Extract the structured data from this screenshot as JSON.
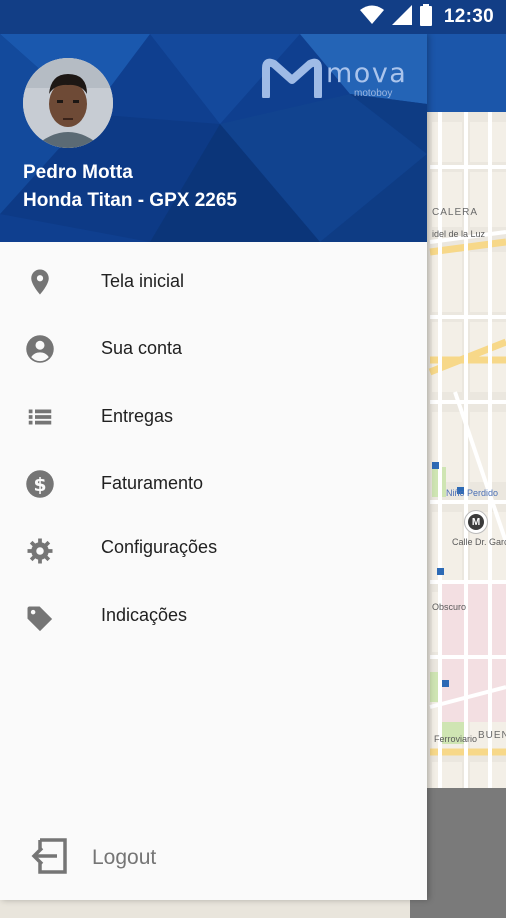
{
  "status_bar": {
    "time": "12:30",
    "icons": [
      "wifi-icon",
      "signal-icon",
      "battery-icon"
    ]
  },
  "brand": {
    "name": "mova",
    "tagline": "motoboy"
  },
  "user": {
    "name": "Pedro Motta",
    "vehicle": "Honda Titan - GPX 2265"
  },
  "menu": [
    {
      "label": "Tela inicial",
      "icon": "location-pin-icon"
    },
    {
      "label": "Sua conta",
      "icon": "account-circle-icon"
    },
    {
      "label": "Entregas",
      "icon": "list-icon"
    },
    {
      "label": "Faturamento",
      "icon": "dollar-circle-icon"
    },
    {
      "label": "Configurações",
      "icon": "gear-icon"
    },
    {
      "label": "Indicações",
      "icon": "tag-icon"
    }
  ],
  "logout": {
    "label": "Logout",
    "icon": "logout-icon"
  },
  "map_labels": {
    "calera": "CALERA",
    "luz": "idel de la Luz",
    "nino_perdido": "Niño Perdido",
    "calle_garcia": "Calle Dr. García",
    "obscuro": "Obscuro",
    "buenos": "BUENOS",
    "ferroviario": "Ferroviario"
  },
  "colors": {
    "status_bar": "#123e86",
    "app_bar": "#1b56aa",
    "drawer_header": "#0f3f8f",
    "drawer_bg": "#fafafa",
    "icon_grey": "#757575"
  }
}
